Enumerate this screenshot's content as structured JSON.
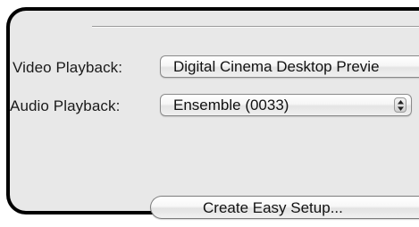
{
  "settings": {
    "video_playback_label": "Video Playback:",
    "video_playback_value": "Digital Cinema Desktop Previe",
    "audio_playback_label": "Audio Playback:",
    "audio_playback_value": "Ensemble (0033)"
  },
  "actions": {
    "create_easy_setup_label": "Create Easy Setup..."
  },
  "icons": {
    "popup_stepper": "up-down-arrows-icon"
  }
}
